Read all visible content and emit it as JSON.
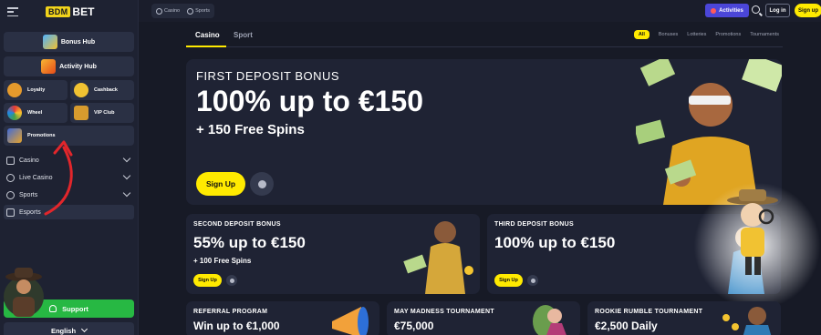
{
  "logo": {
    "box_text": "BDM",
    "text": "BET"
  },
  "sidebar": {
    "bonus_hub": "Bonus Hub",
    "activity_hub": "Activity Hub",
    "grid": [
      {
        "label": "Loyalty",
        "icon": "loyalty-icon"
      },
      {
        "label": "Cashback",
        "icon": "cashback-icon"
      },
      {
        "label": "Wheel",
        "icon": "wheel-icon"
      },
      {
        "label": "VIP Club",
        "icon": "vip-club-icon"
      }
    ],
    "promotions": "Promotions",
    "nav": [
      {
        "label": "Casino",
        "icon": "casino-icon"
      },
      {
        "label": "Live Casino",
        "icon": "live-casino-icon"
      },
      {
        "label": "Sports",
        "icon": "sports-icon"
      },
      {
        "label": "Esports",
        "icon": "esports-icon"
      }
    ],
    "support": "Support",
    "language": "English"
  },
  "topbar": {
    "pills": [
      "Casino",
      "Sports"
    ],
    "activities": "Activities",
    "login": "Log in",
    "signup": "Sign up"
  },
  "tabs": {
    "items": [
      "Casino",
      "Sport"
    ],
    "active": "Casino",
    "filters": [
      "All",
      "Bonuses",
      "Lotteries",
      "Promotions",
      "Tournaments"
    ]
  },
  "hero": {
    "eyebrow": "FIRST DEPOSIT BONUS",
    "headline": "100% up to €150",
    "sub": "+ 150 Free Spins",
    "cta": "Sign Up"
  },
  "cards": [
    {
      "title": "SECOND DEPOSIT BONUS",
      "value": "55% up to €150",
      "sub": "+ 100 Free Spins",
      "cta": "Sign Up"
    },
    {
      "title": "THIRD DEPOSIT BONUS",
      "value": "100% up to €150",
      "sub": "",
      "cta": "Sign Up"
    },
    {
      "title": "REFERRAL PROGRAM",
      "value": "Win up to €1,000"
    },
    {
      "title": "MAY MADNESS TOURNAMENT",
      "value": "€75,000"
    },
    {
      "title": "ROOKIE RUMBLE TOURNAMENT",
      "value": "€2,500 Daily"
    }
  ],
  "colors": {
    "accent": "#ffea00",
    "support": "#27b843",
    "activities": "#4b46d8",
    "annotation_arrow": "#e2262b"
  }
}
